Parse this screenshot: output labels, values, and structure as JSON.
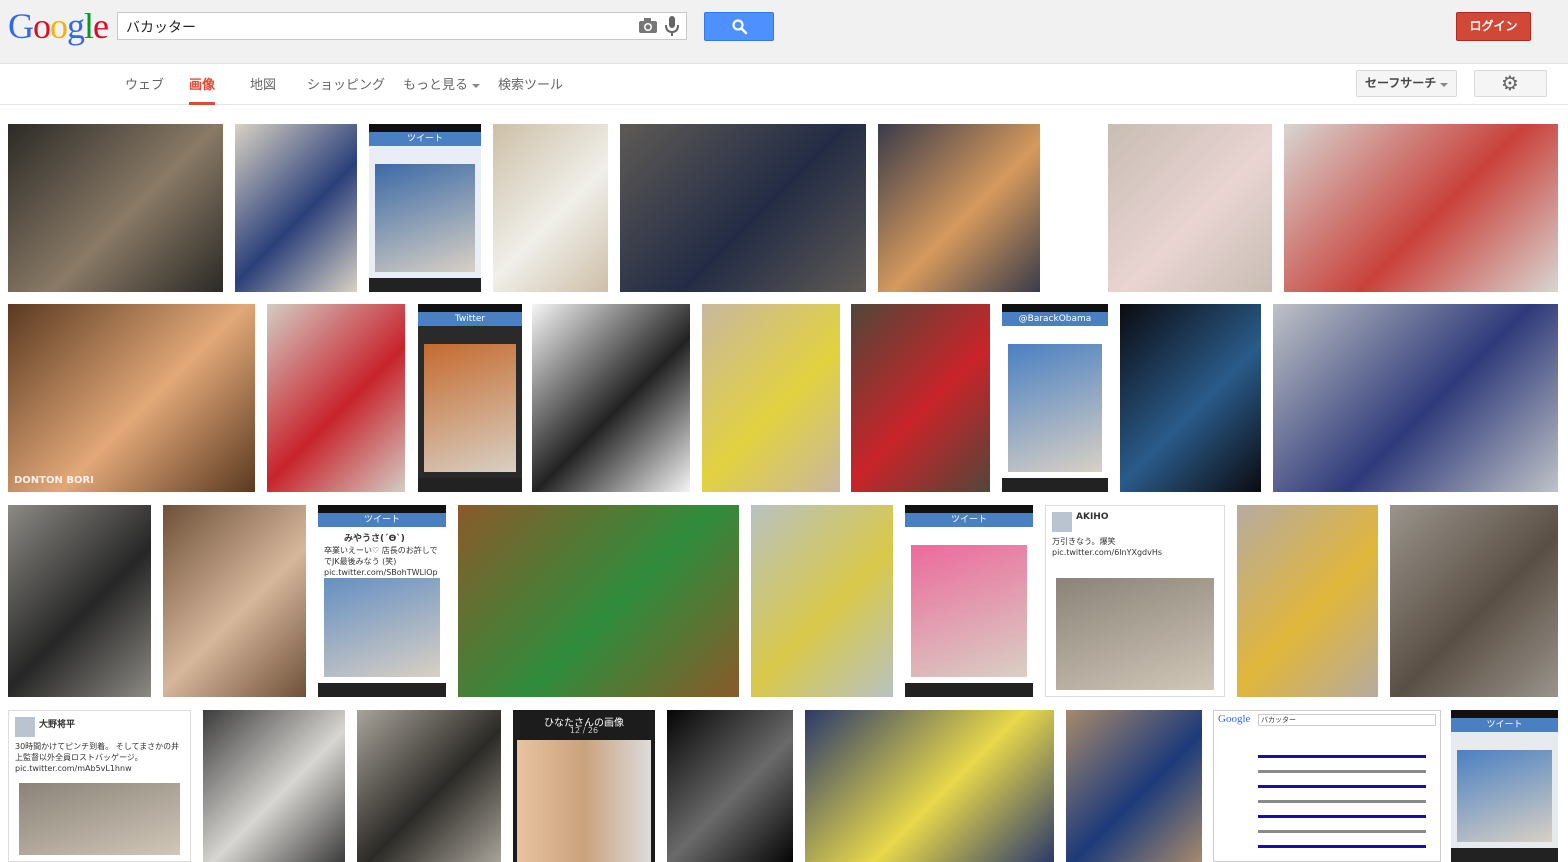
{
  "logo": {
    "letters": [
      {
        "ch": "G",
        "color": "#3369e8"
      },
      {
        "ch": "o",
        "color": "#d50f25"
      },
      {
        "ch": "o",
        "color": "#eeb211"
      },
      {
        "ch": "g",
        "color": "#3369e8"
      },
      {
        "ch": "l",
        "color": "#009925"
      },
      {
        "ch": "e",
        "color": "#d50f25"
      }
    ]
  },
  "search": {
    "query": "バカッター",
    "camera_icon": "camera-icon",
    "mic_icon": "microphone-icon",
    "button_icon": "search-icon"
  },
  "header": {
    "login_label": "ログイン"
  },
  "nav": {
    "tabs": [
      "ウェブ",
      "画像",
      "地図",
      "ショッピング",
      "もっと見る",
      "検索ツール"
    ],
    "active_tab": "画像",
    "safesearch_label": "セーフサーチ",
    "settings_icon": "gear-icon"
  },
  "images": {
    "row1": [
      {
        "id": "r1c1",
        "bg": "#2b2a26",
        "accent": "#8a7a66"
      },
      {
        "id": "r1c2",
        "bg": "#d9d2c4",
        "accent": "#2a3f7a"
      },
      {
        "id": "r1c3",
        "bg": "#e9eef4",
        "accent": "#3b6aa6",
        "kind": "phone",
        "header": "ツイート"
      },
      {
        "id": "r1c4",
        "bg": "#cdbfa7",
        "accent": "#f0efe9"
      },
      {
        "id": "r1c5",
        "bg": "#5e5a55",
        "accent": "#232c45"
      },
      {
        "id": "r1c6",
        "bg": "#3a3b4a",
        "accent": "#d69a5d"
      },
      {
        "id": "r1c7",
        "bg": "#c8bdb3",
        "accent": "#e9d4d2"
      },
      {
        "id": "r1c8",
        "bg": "#d8d5d2",
        "accent": "#c9413a"
      }
    ],
    "row2": [
      {
        "id": "r2c1",
        "bg": "#5a3920",
        "accent": "#e2a878",
        "label": "DONTON BORI"
      },
      {
        "id": "r2c2",
        "bg": "#d3ccc4",
        "accent": "#c8232c"
      },
      {
        "id": "r2c3",
        "bg": "#2a2a2a",
        "accent": "#c56a2e",
        "kind": "phone",
        "header": "Twitter"
      },
      {
        "id": "r2c4",
        "bg": "#f5f5f5",
        "accent": "#222222"
      },
      {
        "id": "r2c5",
        "bg": "#c9b79f",
        "accent": "#e2d240"
      },
      {
        "id": "r2c6",
        "bg": "#514638",
        "accent": "#c9242a"
      },
      {
        "id": "r2c7",
        "bg": "#ffffff",
        "accent": "#4a80c2",
        "kind": "phone",
        "header": "@BarackObama"
      },
      {
        "id": "r2c8",
        "bg": "#0b0b10",
        "accent": "#2a5b8a"
      },
      {
        "id": "r2c9",
        "bg": "#bfc2c6",
        "accent": "#2e3a7a"
      }
    ],
    "row3": [
      {
        "id": "r3c1",
        "bg": "#8c8a84",
        "accent": "#262626"
      },
      {
        "id": "r3c2",
        "bg": "#6e5038",
        "accent": "#d6b79c"
      },
      {
        "id": "r3c3",
        "bg": "#ffffff",
        "accent": "#4a80c2",
        "kind": "tweetphone",
        "header": "ツイート",
        "name": "みやうさ(´Θ`)",
        "text": "卒業いえーい♡ 店長のお許しで でJK最後みなう (笑) pic.twitter.com/SBohTWLlOp"
      },
      {
        "id": "r3c4",
        "bg": "#8a5a2a",
        "accent": "#2f8c3c"
      },
      {
        "id": "r3c5",
        "bg": "#b8c2c0",
        "accent": "#d9c94a"
      },
      {
        "id": "r3c6",
        "bg": "#ffffff",
        "accent": "#ec6a9c",
        "kind": "phone",
        "header": "ツイート"
      },
      {
        "id": "r3c7",
        "bg": "#ffffff",
        "accent": "#333333",
        "kind": "tweet",
        "name": "AKIHO",
        "text": "万引きなう。爆笑 pic.twitter.com/6lnYXgdvHs"
      },
      {
        "id": "r3c8",
        "bg": "#b7aba0",
        "accent": "#e0b63a"
      },
      {
        "id": "r3c9",
        "bg": "#9a948c",
        "accent": "#5a4f44"
      }
    ],
    "row4": [
      {
        "id": "r4c1",
        "bg": "#ffffff",
        "accent": "#333333",
        "kind": "tweet",
        "name": "大野将平",
        "text": "30時間かけてピンチ到着。 そしてまさかの井上監督以外全員ロストバッゲージ。 pic.twitter.com/mAb5vL1hnw"
      },
      {
        "id": "r4c2",
        "bg": "#3c3c3c",
        "accent": "#d8d6d2"
      },
      {
        "id": "r4c3",
        "bg": "#a8a39a",
        "accent": "#2c2a26"
      },
      {
        "id": "r4c4",
        "bg": "#1c1c1c",
        "accent": "#f0c8a4",
        "kind": "dark",
        "header": "ひなたさんの画像",
        "sub": "12 / 26"
      },
      {
        "id": "r4c5",
        "bg": "#050505",
        "accent": "#6a6a6a"
      },
      {
        "id": "r4c6",
        "bg": "#2b3a6a",
        "accent": "#e8d84a"
      },
      {
        "id": "r4c7",
        "bg": "#a68a6c",
        "accent": "#1c3a7a"
      },
      {
        "id": "r4c8",
        "bg": "#ffffff",
        "accent": "#1a0dab",
        "kind": "gsmall",
        "query": "バカッター"
      },
      {
        "id": "r4c9",
        "bg": "#e7eaef",
        "accent": "#4a80c2",
        "kind": "phone",
        "header": "ツイート"
      }
    ]
  }
}
